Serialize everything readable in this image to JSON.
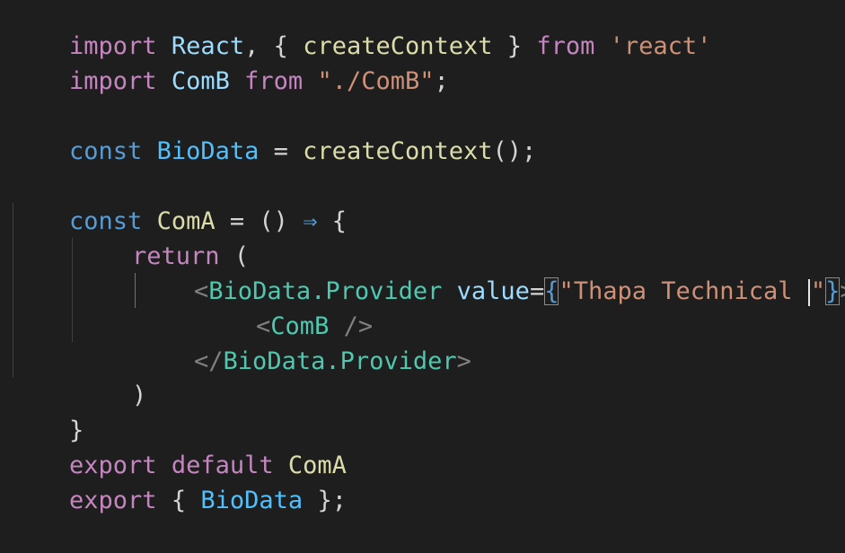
{
  "editor": {
    "language": "javascript-react",
    "colors": {
      "background": "#1e1e1e",
      "keyword_import": "#c586c0",
      "keyword_decl": "#569cd6",
      "function": "#dcdcaa",
      "string": "#ce9178",
      "jsx_tag": "#4ec9b0",
      "identifier": "#9cdcfe"
    },
    "lines": {
      "l1": {
        "kw_import": "import",
        "ident1": "React",
        "comma": ",",
        "open_brace": "{",
        "fn": "createContext",
        "close_brace": "}",
        "kw_from": "from",
        "str": "'react'"
      },
      "l2": {
        "kw_import": "import",
        "ident": "ComB",
        "kw_from": "from",
        "str": "\"./ComB\"",
        "semi": ";"
      },
      "l4": {
        "kw_const": "const",
        "var": "BioData",
        "eq": "=",
        "fn": "createContext",
        "parens": "();"
      },
      "l6": {
        "kw_const": "const",
        "fn": "ComA",
        "eq": "=",
        "parens": "()",
        "arrow": "⇒",
        "open_brace": "{"
      },
      "l7": {
        "kw_return": "return",
        "paren": "("
      },
      "l8": {
        "lt": "<",
        "tag": "BioData.Provider",
        "attr": "value",
        "eq": "=",
        "open_brace": "{",
        "str_before_caret": "\"Thapa Technical ",
        "str_after_caret": "\"",
        "close_brace": "}",
        "gt": ">"
      },
      "l9": {
        "lt": "<",
        "tag": "ComB",
        "self_close": "/>"
      },
      "l10": {
        "lt": "</",
        "tag": "BioData.Provider",
        "gt": ">"
      },
      "l11": {
        "paren": ")"
      },
      "l12": {
        "close_brace": "}"
      },
      "l13": {
        "kw_export": "export",
        "kw_default": "default",
        "fn": "ComA"
      },
      "l14": {
        "kw_export": "export",
        "open_brace": "{",
        "var": "BioData",
        "close_brace": "}",
        "semi": ";"
      }
    }
  }
}
